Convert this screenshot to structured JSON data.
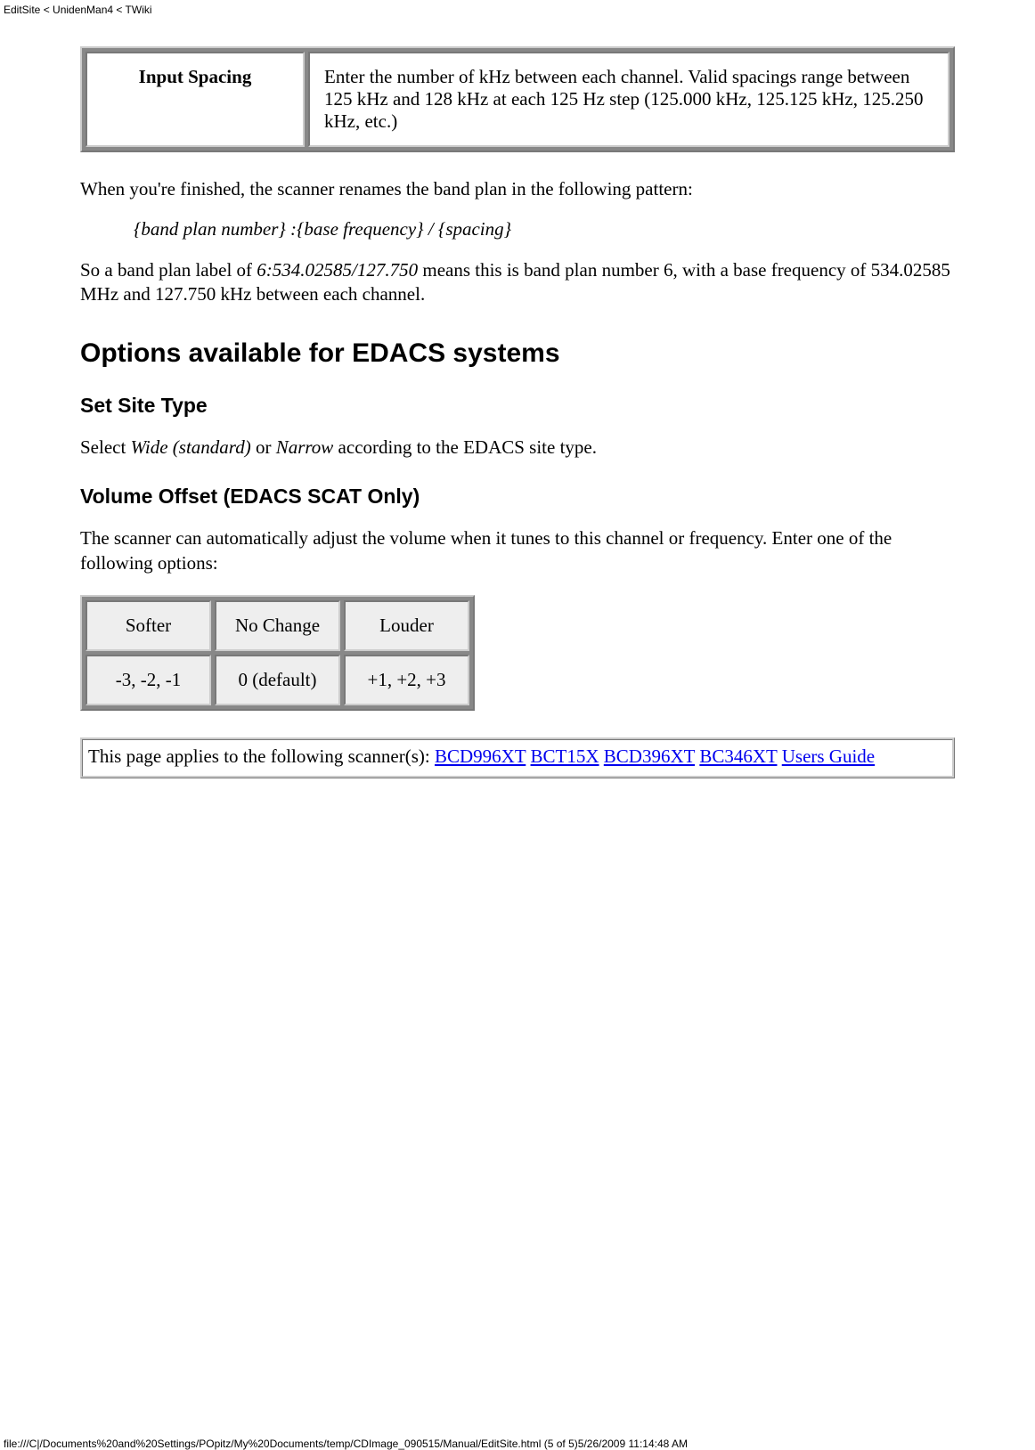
{
  "header": "EditSite < UnidenMan4 < TWiki",
  "table1": {
    "label": "Input Spacing",
    "desc": "Enter the number of kHz between each channel. Valid spacings range between 125 kHz and 128 kHz at each 125 Hz step (125.000 kHz, 125.125 kHz, 125.250 kHz, etc.)"
  },
  "para1": "When you're finished, the scanner renames the band plan in the following pattern:",
  "pattern": "{band plan number} :{base frequency} / {spacing}",
  "para2a": "So a band plan label of ",
  "para2b": "6:534.02585/127.750",
  "para2c": " means this is band plan number 6, with a base frequency of 534.02585 MHz and 127.750 kHz between each channel.",
  "h2_edacs": "Options available for EDACS systems",
  "h3_sitetype": "Set Site Type",
  "sitetype_a": "Select ",
  "sitetype_b": "Wide (standard)",
  "sitetype_c": " or ",
  "sitetype_d": "Narrow",
  "sitetype_e": " according to the EDACS site type.",
  "h3_volume": "Volume Offset (EDACS SCAT Only)",
  "volume_desc": "The scanner can automatically adjust the volume when it tunes to this channel or frequency. Enter one of the following options:",
  "voltable": {
    "h1": "Softer",
    "h2": "No Change",
    "h3": "Louder",
    "v1": "-3, -2, -1",
    "v2": "0 (default)",
    "v3": "+1, +2, +3"
  },
  "applies": {
    "intro": "This page applies to the following scanner(s): ",
    "links": [
      "BCD996XT",
      "BCT15X",
      "BCD396XT",
      "BC346XT",
      "Users Guide"
    ]
  },
  "footer": "file:///C|/Documents%20and%20Settings/POpitz/My%20Documents/temp/CDImage_090515/Manual/EditSite.html (5 of 5)5/26/2009 11:14:48 AM"
}
